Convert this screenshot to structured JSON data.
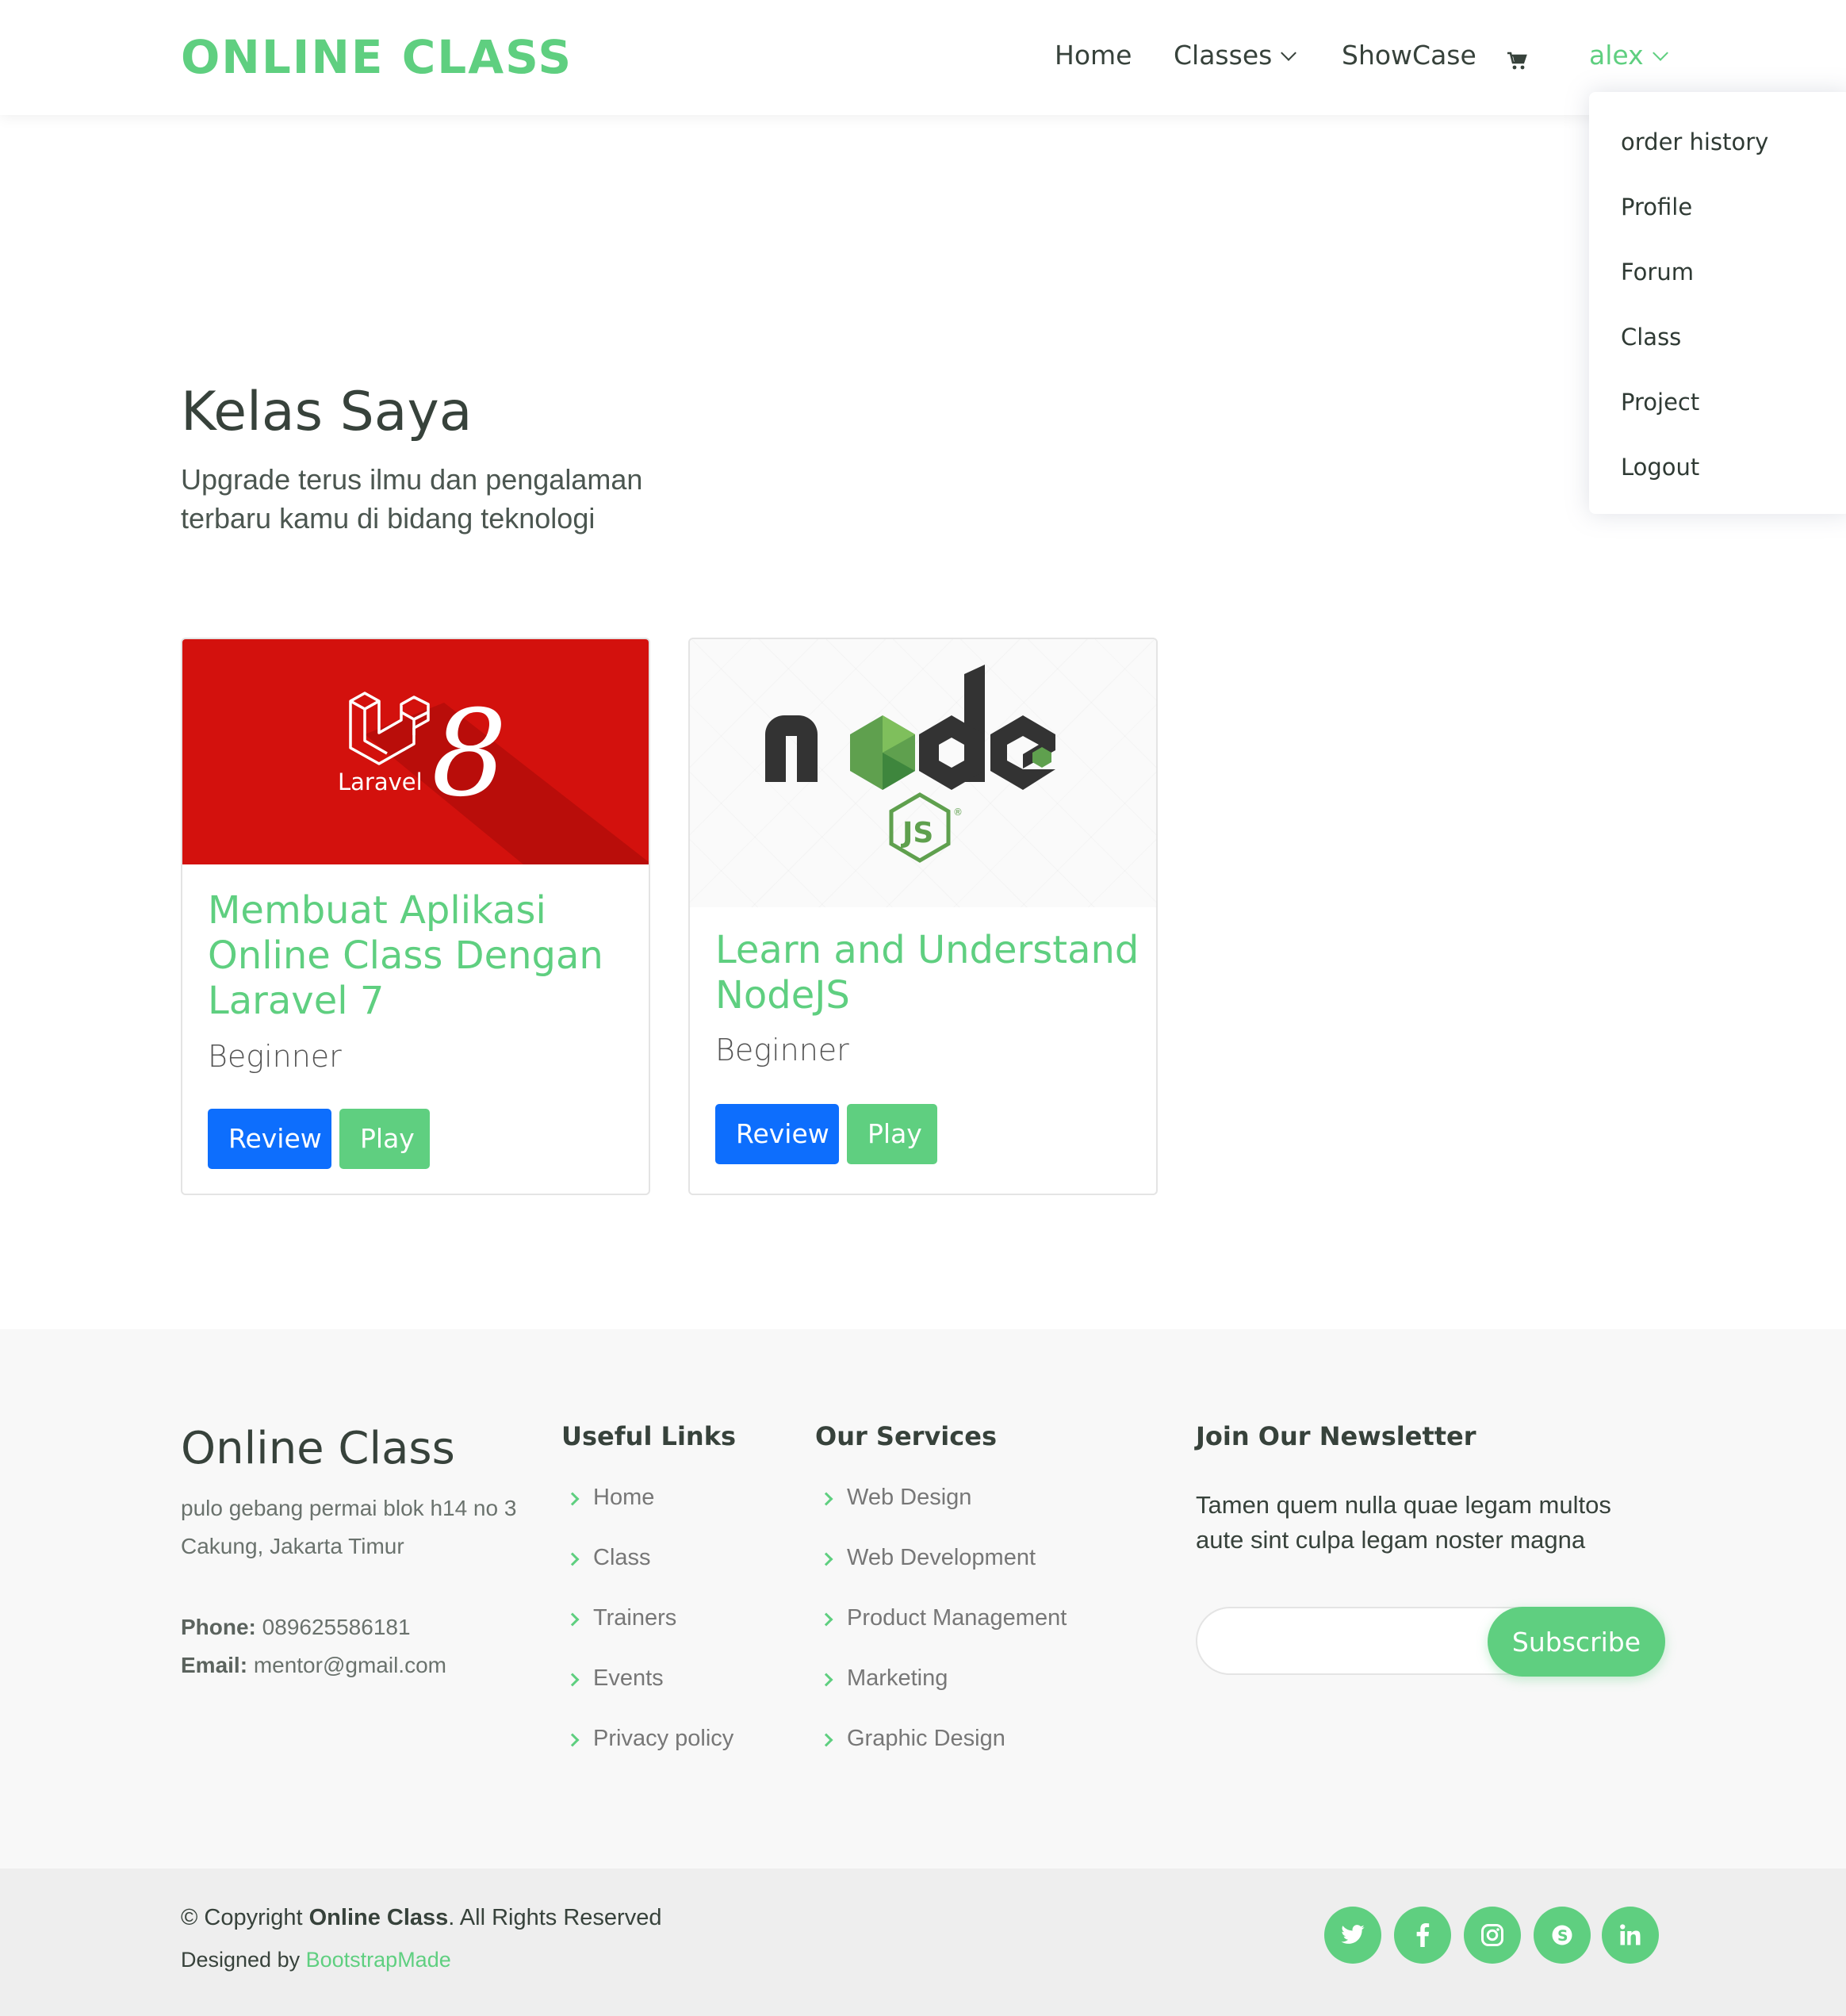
{
  "header": {
    "logo": "ONLINE CLASS",
    "nav": {
      "home": "Home",
      "classes": "Classes",
      "showcase": "ShowCase",
      "user": "alex"
    },
    "cart_icon": "cart-icon"
  },
  "user_menu": {
    "items": [
      "order history",
      "Profile",
      "Forum",
      "Class",
      "Project",
      "Logout"
    ]
  },
  "hero": {
    "title": "Kelas Saya",
    "subtitle": "Upgrade terus ilmu dan pengalaman terbaru kamu di bidang teknologi"
  },
  "courses": [
    {
      "thumb_logo_text": "Laravel",
      "thumb_version": "8",
      "title": "Membuat Aplikasi Online Class Dengan Laravel 7",
      "level": "Beginner",
      "review_label": "Review",
      "play_label": "Play"
    },
    {
      "thumb_logo_text": "node JS",
      "title": "Learn and Understand NodeJS",
      "level": "Beginner",
      "review_label": "Review",
      "play_label": "Play"
    }
  ],
  "footer": {
    "brand": "Online Class",
    "address": "pulo gebang permai blok h14 no 3 Cakung, Jakarta Timur",
    "phone_label": "Phone:",
    "phone": "089625586181",
    "email_label": "Email:",
    "email": "mentor@gmail.com",
    "useful_links": {
      "heading": "Useful Links",
      "items": [
        "Home",
        "Class",
        "Trainers",
        "Events",
        "Privacy policy"
      ]
    },
    "services": {
      "heading": "Our Services",
      "items": [
        "Web Design",
        "Web Development",
        "Product Management",
        "Marketing",
        "Graphic Design"
      ]
    },
    "newsletter": {
      "heading": "Join Our Newsletter",
      "text": "Tamen quem nulla quae legam multos aute sint culpa legam noster magna",
      "input_value": "",
      "subscribe_label": "Subscribe"
    },
    "copyright_prefix": "© Copyright",
    "copyright_brand": "Online Class",
    "copyright_suffix": ". All Rights Reserved",
    "designed_by_prefix": "Designed by",
    "designed_by_link": "BootstrapMade",
    "social_icons": [
      "twitter-icon",
      "facebook-icon",
      "instagram-icon",
      "skype-icon",
      "linkedin-icon"
    ]
  },
  "colors": {
    "accent": "#5fcf80",
    "primary_button": "#0d6efd",
    "laravel_red": "#d3110d",
    "text_dark": "#37423b"
  }
}
